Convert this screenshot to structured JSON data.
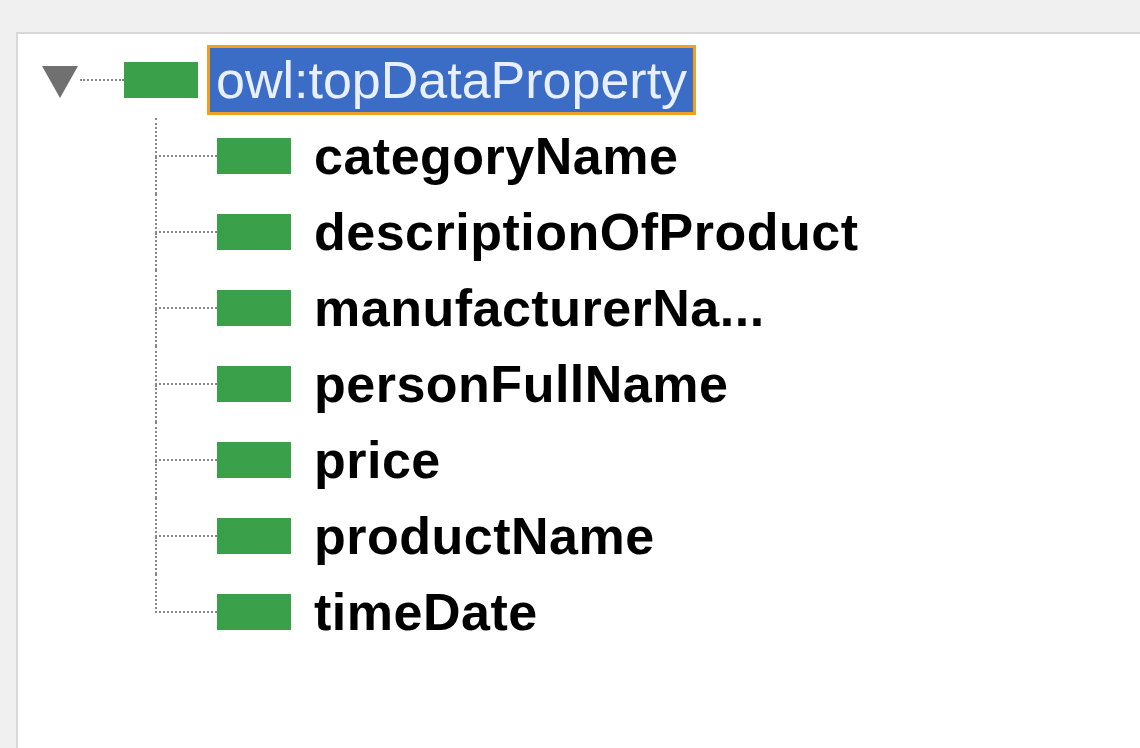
{
  "tree": {
    "root": {
      "label": "owl:topDataProperty",
      "selected": true,
      "expanded": true,
      "children": [
        {
          "label": "categoryName",
          "selected": false
        },
        {
          "label": "descriptionOfProduct",
          "selected": false
        },
        {
          "label": "manufacturerNa...",
          "selected": false
        },
        {
          "label": "personFullName",
          "selected": false
        },
        {
          "label": "price",
          "selected": false
        },
        {
          "label": "productName",
          "selected": false
        },
        {
          "label": "timeDate",
          "selected": false
        }
      ]
    }
  }
}
